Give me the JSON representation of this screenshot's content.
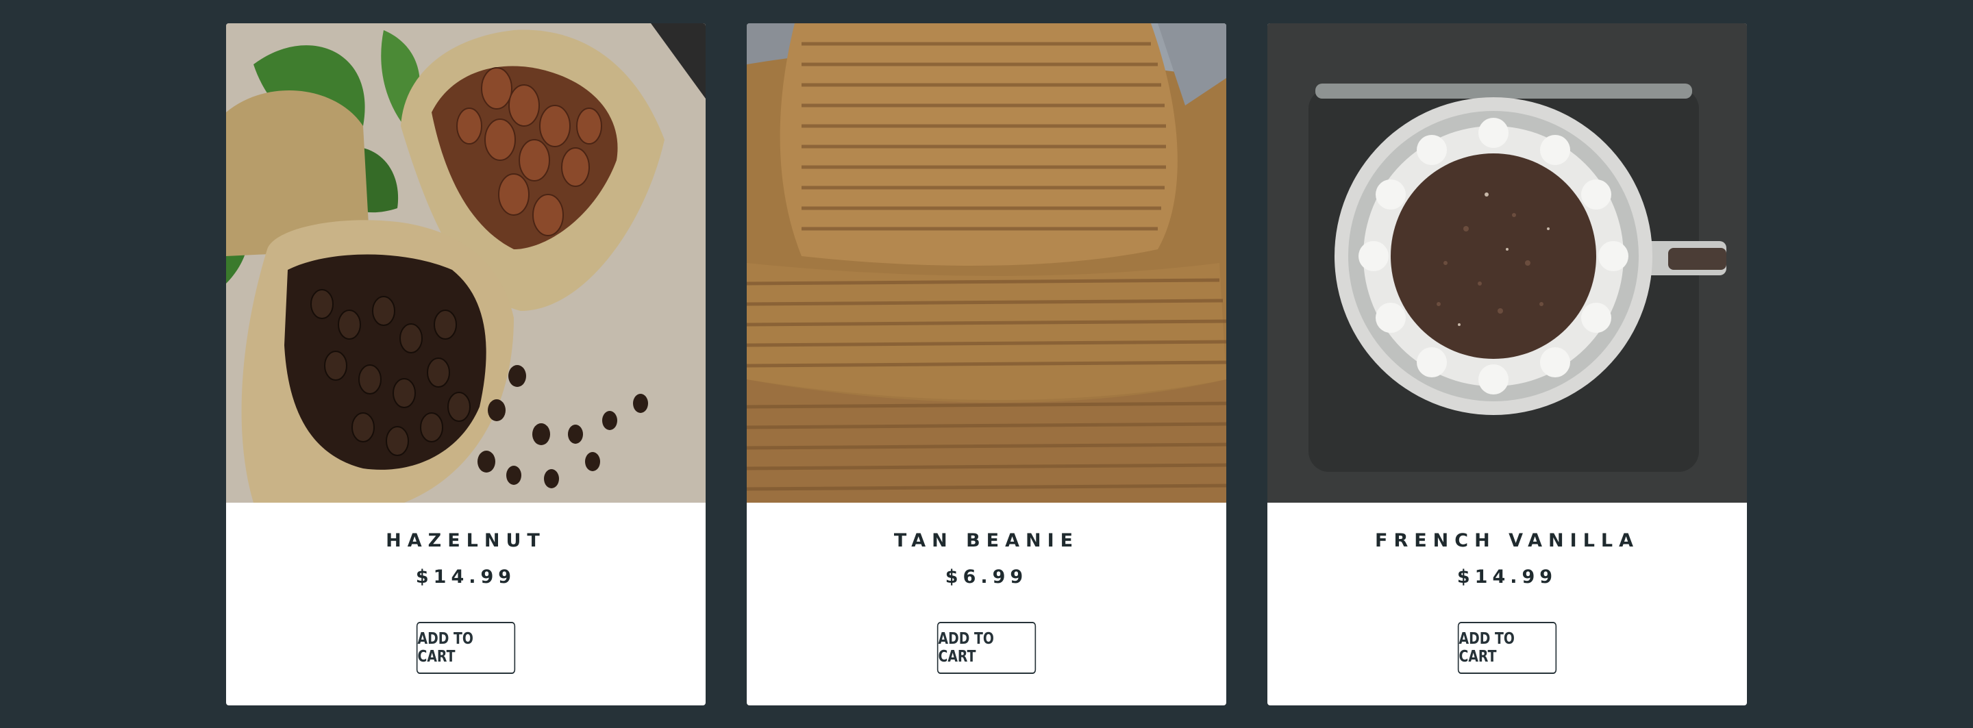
{
  "colors": {
    "background": "#263238",
    "card": "#ffffff",
    "text": "#1f2a2e",
    "button_border": "#263238"
  },
  "products": [
    {
      "name": "HAZELNUT",
      "price": "$14.99",
      "button_label": "ADD TO CART",
      "image": "coffee-beans-burlap-sacks-image"
    },
    {
      "name": "TAN BEANIE",
      "price": "$6.99",
      "button_label": "ADD TO CART",
      "image": "knit-beanie-image"
    },
    {
      "name": "FRENCH VANILLA",
      "price": "$14.99",
      "button_label": "ADD TO CART",
      "image": "pour-over-coffee-image"
    }
  ]
}
